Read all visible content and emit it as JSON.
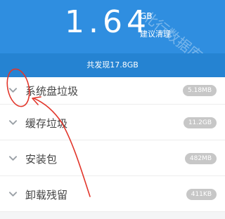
{
  "header": {
    "big_value": "1.64",
    "unit": "GB",
    "suggest_label": "建议清理",
    "watermark": "北行数据库",
    "bg_color": "#2f8ee0"
  },
  "summary": {
    "found_text": "共发现17.8GB",
    "bg_color": "#2583d2"
  },
  "list": {
    "items": [
      {
        "label": "系统盘垃圾",
        "size": "5.18MB",
        "icon": "chevron-down-icon"
      },
      {
        "label": "缓存垃圾",
        "size": "11.2GB",
        "icon": "chevron-down-icon"
      },
      {
        "label": "安装包",
        "size": "482MB",
        "icon": "chevron-down-icon"
      },
      {
        "label": "卸载残留",
        "size": "411KB",
        "icon": "chevron-down-icon"
      }
    ]
  },
  "annotation": {
    "color": "#e2362b"
  }
}
